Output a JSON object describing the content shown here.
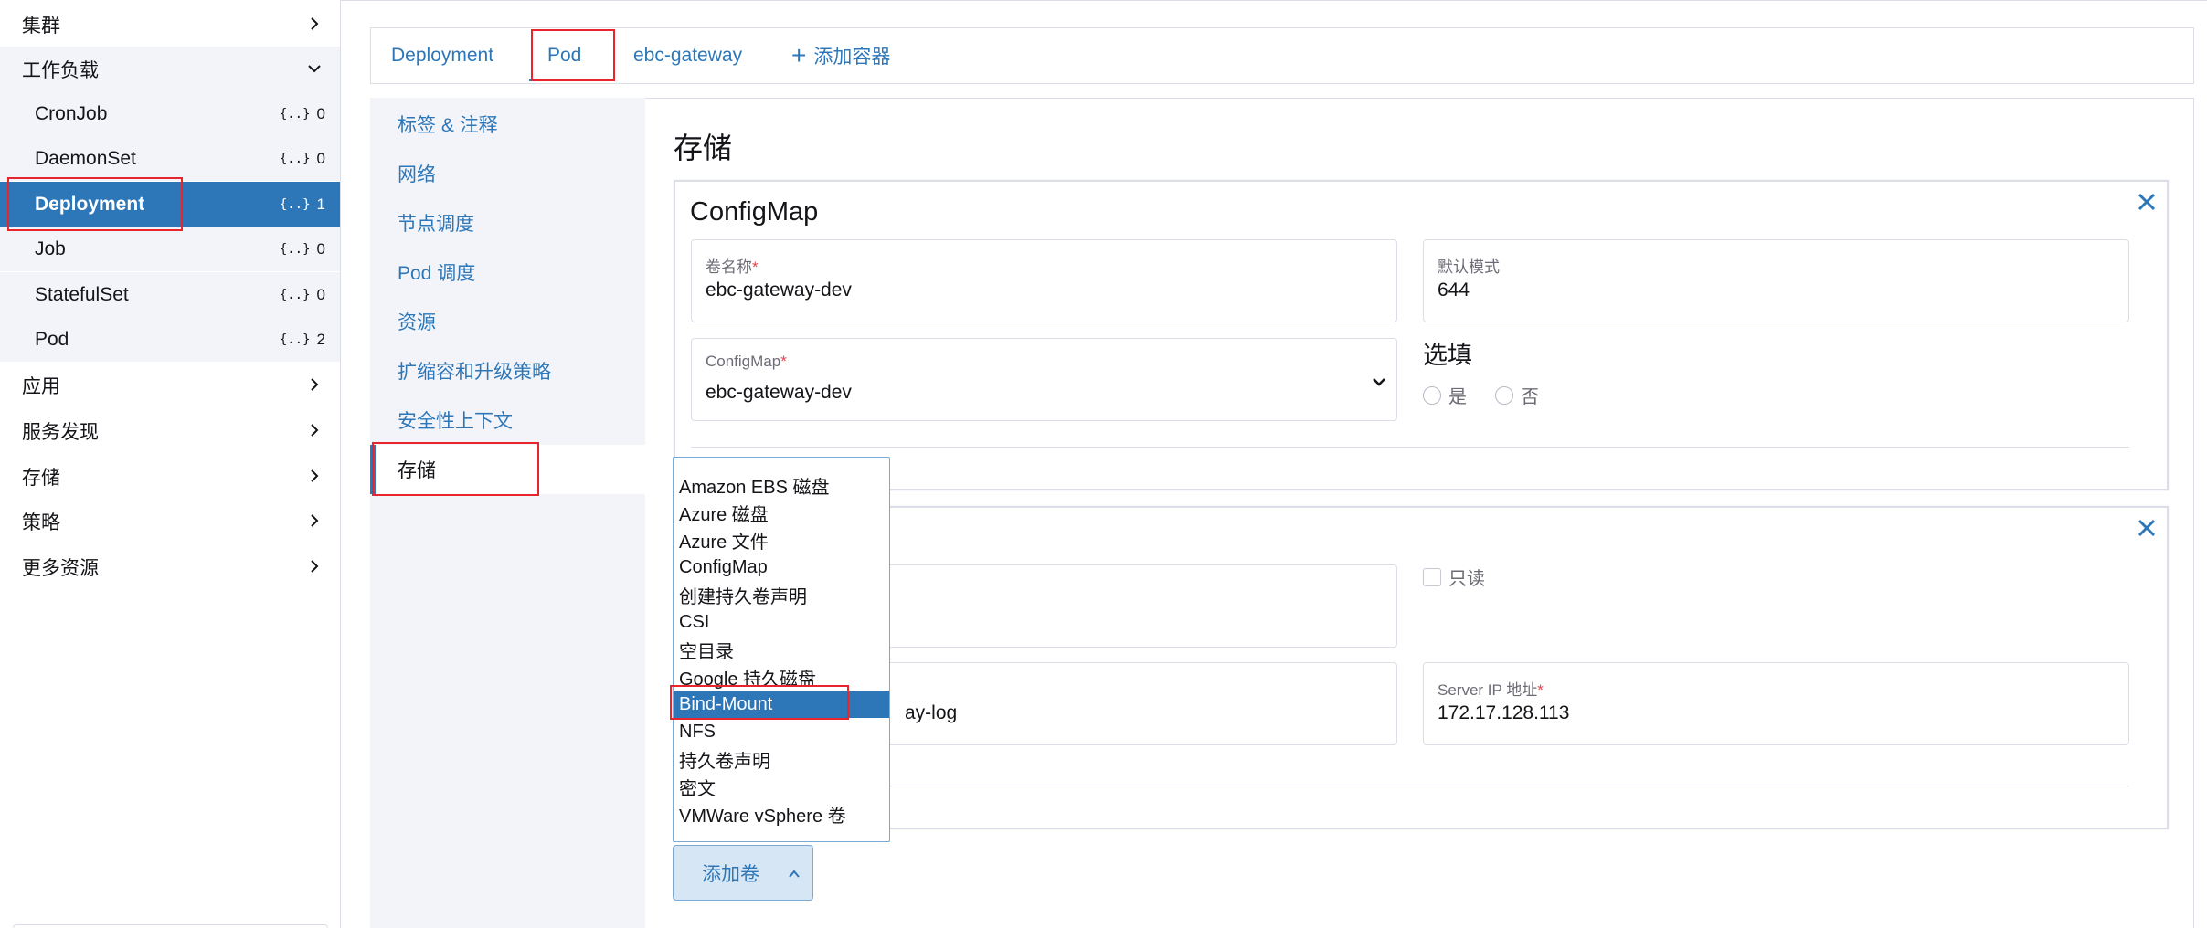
{
  "sidebar": {
    "items": [
      {
        "label": "集群",
        "type": "group",
        "expanded": false
      },
      {
        "label": "工作负载",
        "type": "group",
        "expanded": true
      },
      {
        "label": "CronJob",
        "type": "child",
        "count": "0"
      },
      {
        "label": "DaemonSet",
        "type": "child",
        "count": "0"
      },
      {
        "label": "Deployment",
        "type": "child",
        "count": "1",
        "active": true
      },
      {
        "label": "Job",
        "type": "child",
        "count": "0"
      },
      {
        "label": "StatefulSet",
        "type": "child",
        "count": "0"
      },
      {
        "label": "Pod",
        "type": "child",
        "count": "2"
      },
      {
        "label": "应用",
        "type": "group",
        "expanded": false
      },
      {
        "label": "服务发现",
        "type": "group",
        "expanded": false
      },
      {
        "label": "存储",
        "type": "group",
        "expanded": false
      },
      {
        "label": "策略",
        "type": "group",
        "expanded": false
      },
      {
        "label": "更多资源",
        "type": "group",
        "expanded": false
      }
    ],
    "count_icon": "{..}"
  },
  "tabs": {
    "items": [
      "Deployment",
      "Pod",
      "ebc-gateway"
    ],
    "active": "Pod",
    "add_label": "添加容器",
    "add_icon": "+"
  },
  "subnav": {
    "items": [
      "标签 & 注释",
      "网络",
      "节点调度",
      "Pod 调度",
      "资源",
      "扩缩容和升级策略",
      "安全性上下文",
      "存储"
    ],
    "active": "存储"
  },
  "storage": {
    "title": "存储",
    "volume1": {
      "title": "ConfigMap",
      "name_label": "卷名称",
      "name_value": "ebc-gateway-dev",
      "mode_label": "默认模式",
      "mode_value": "644",
      "configmap_label": "ConfigMap",
      "configmap_value": "ebc-gateway-dev",
      "optional_title": "选填",
      "radio_yes": "是",
      "radio_no": "否"
    },
    "volume2": {
      "readonly_label": "只读",
      "path_value_partial": "ay-log",
      "server_label": "Server IP 地址",
      "server_value": "172.17.128.113"
    },
    "required_mark": "*"
  },
  "dropdown": {
    "options": [
      "Amazon EBS 磁盘",
      "Azure 磁盘",
      "Azure 文件",
      "ConfigMap",
      "创建持久卷声明",
      "CSI",
      "空目录",
      "Google 持久磁盘",
      "Bind-Mount",
      "NFS",
      "持久卷声明",
      "密文",
      "VMWare vSphere 卷"
    ],
    "selected": "Bind-Mount"
  },
  "add_volume_button": {
    "label": "添加卷"
  },
  "colors": {
    "accent": "#2d77b8",
    "highlight": "#e8242d",
    "panel": "#f3f4f9"
  }
}
